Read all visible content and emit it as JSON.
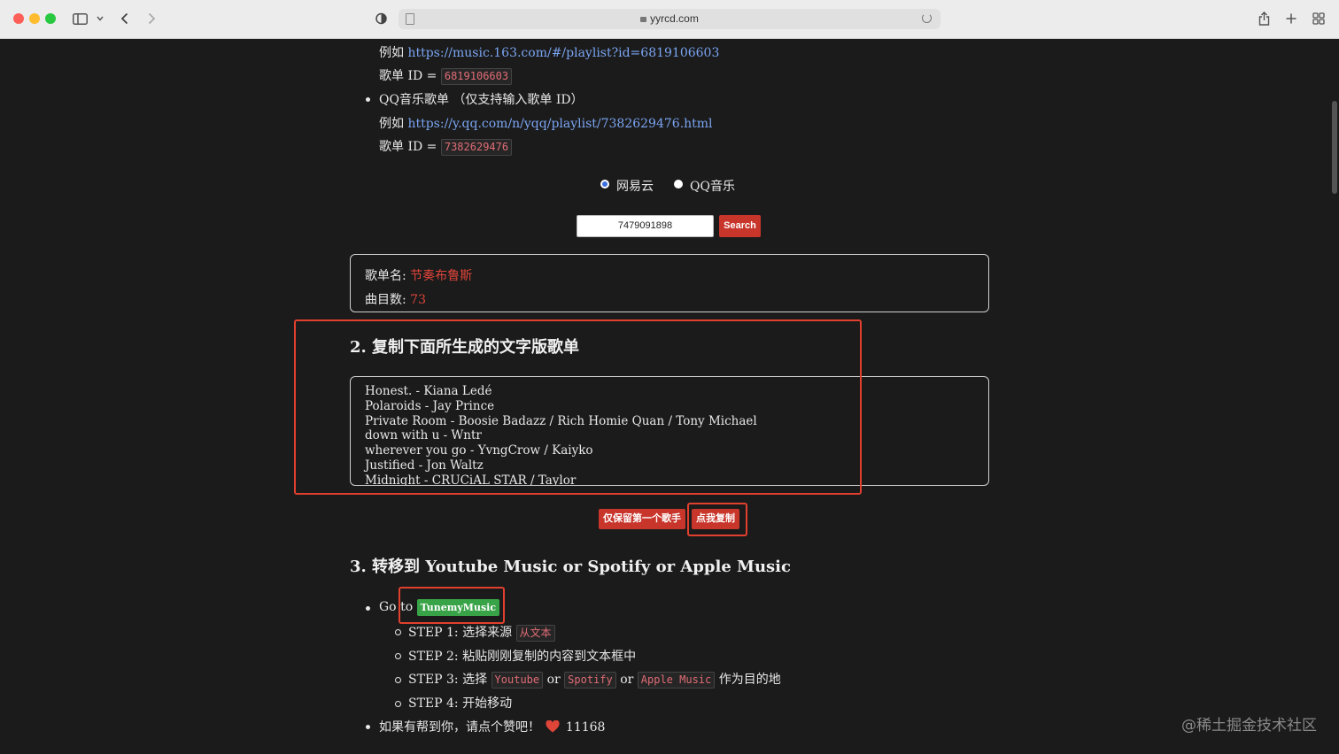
{
  "browser": {
    "url": "yyrcd.com"
  },
  "instructions": {
    "netease_example_prefix": "例如",
    "netease_example_link": "https://music.163.com/#/playlist?id=6819106603",
    "netease_id_label": "歌单 ID =",
    "netease_id_value": "6819106603",
    "qq_title": "QQ音乐歌单 （仅支持输入歌单 ID）",
    "qq_example_prefix": "例如",
    "qq_example_link": "https://y.qq.com/n/yqq/playlist/7382629476.html",
    "qq_id_label": "歌单 ID =",
    "qq_id_value": "7382629476"
  },
  "source_select": {
    "options": [
      "网易云",
      "QQ音乐"
    ],
    "selected": "网易云"
  },
  "search": {
    "value": "7479091898",
    "button_label": "Search"
  },
  "playlist_info": {
    "name_label": "歌单名:",
    "name_value": "节奏布鲁斯",
    "count_label": "曲目数:",
    "count_value": "73"
  },
  "step2": {
    "heading": "2. 复制下面所生成的文字版歌单",
    "songs": [
      "Honest. - Kiana Ledé",
      "Polaroids - Jay Prince",
      "Private Room - Boosie Badazz / Rich Homie Quan / Tony Michael",
      "down with u - Wntr",
      "wherever you go - YvngCrow / Kaiyko",
      "Justified - Jon Waltz",
      "Midnight  - CRUCiAL STAR / Taylor"
    ],
    "keep_first_artist_button": "仅保留第一个歌手",
    "copy_button": "点我复制"
  },
  "step3": {
    "heading": "3. 转移到 Youtube Music or Spotify or Apple Music",
    "go_to": "Go to",
    "tunemymusic_button": "TunemyMusic",
    "step1_text": "STEP 1: 选择来源",
    "step1_code": "从文本",
    "step2_text": "STEP 2: 粘贴刚刚复制的内容到文本框中",
    "step3_text": "STEP 3: 选择",
    "step3_code1": "Youtube",
    "step3_or1": "or",
    "step3_code2": "Spotify",
    "step3_or2": "or",
    "step3_code3": "Apple Music",
    "step3_suffix": "作为目的地",
    "step4_text": "STEP 4: 开始移动",
    "like_text": "如果有帮到你，请点个赞吧！",
    "like_icon": "heart-icon",
    "like_count": "11168"
  },
  "watermark": "@稀土掘金技术社区",
  "colors": {
    "accent_red": "#c8352b",
    "link_blue": "#7aa5f2",
    "green": "#39a348",
    "annotation_red": "#e2402f"
  }
}
